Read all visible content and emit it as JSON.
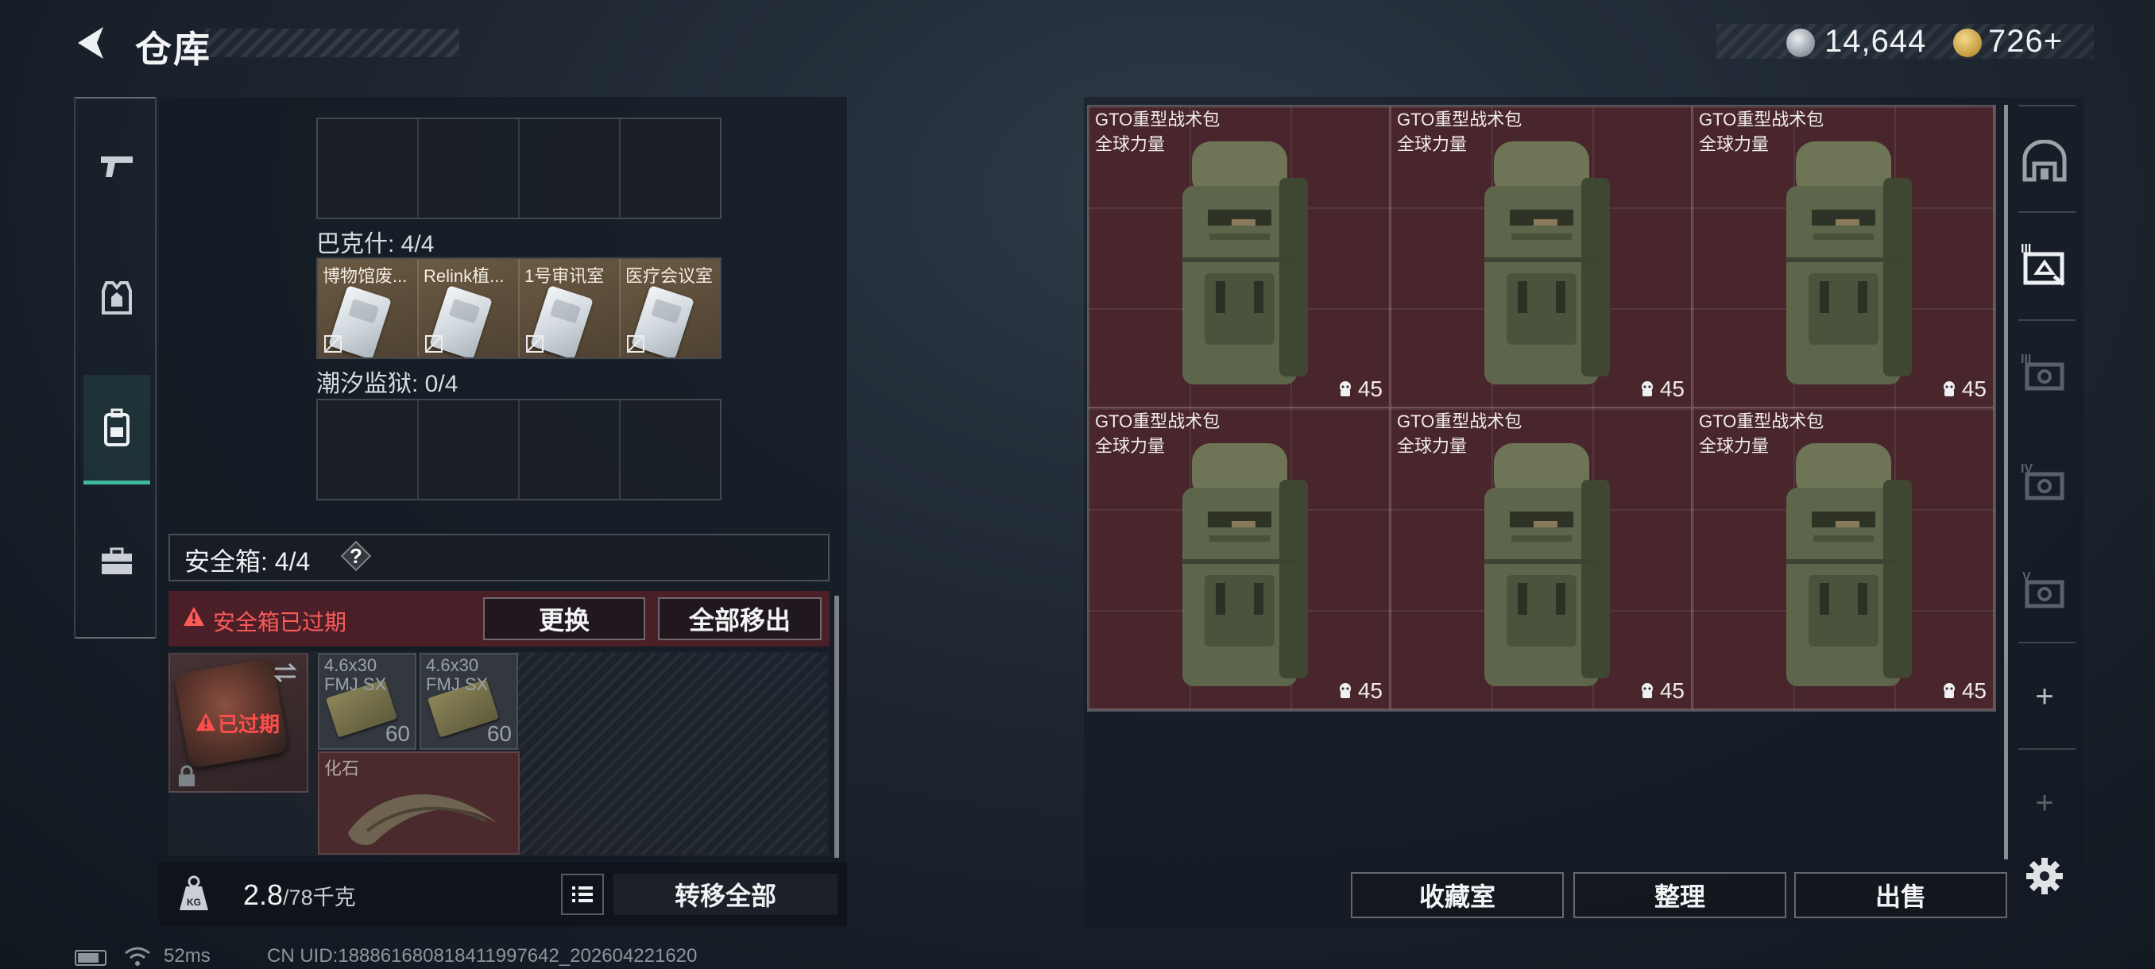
{
  "header": {
    "title": "仓库"
  },
  "currency": {
    "silver": "14,644",
    "gold": "726+"
  },
  "left_nav": [
    "gun-icon",
    "armor-icon",
    "backpack-icon",
    "briefcase-icon"
  ],
  "keys": {
    "top_label": "",
    "bakesh_label": "巴克什: 4/4",
    "bakesh_items": [
      "博物馆废...",
      "Relink植...",
      "1号审讯室",
      "医疗会议室"
    ],
    "tide_label": "潮汐监狱: 0/4"
  },
  "safebox": {
    "title": "安全箱: 4/4",
    "help": "?",
    "warning": "安全箱已过期",
    "replace_button": "更换",
    "move_all_button": "全部移出",
    "expired_badge": "已过期",
    "items": [
      {
        "name": "4.6x30 FMJ SX",
        "count": "60"
      },
      {
        "name": "4.6x30 FMJ SX",
        "count": "60"
      }
    ],
    "fossil_name": "化石"
  },
  "weight": {
    "current": "2.8",
    "max": "/78千克"
  },
  "transfer_all_button": "转移全部",
  "storage": {
    "items": [
      {
        "name": "GTO重型战术包",
        "brand": "全球力量",
        "durability": "45"
      },
      {
        "name": "GTO重型战术包",
        "brand": "全球力量",
        "durability": "45"
      },
      {
        "name": "GTO重型战术包",
        "brand": "全球力量",
        "durability": "45"
      },
      {
        "name": "GTO重型战术包",
        "brand": "全球力量",
        "durability": "45"
      },
      {
        "name": "GTO重型战术包",
        "brand": "全球力量",
        "durability": "45"
      },
      {
        "name": "GTO重型战术包",
        "brand": "全球力量",
        "durability": "45"
      }
    ],
    "buttons": {
      "collection": "收藏室",
      "organize": "整理",
      "sell": "出售"
    }
  },
  "right_nav": {
    "tier3": "III",
    "tier4": "IV",
    "tier5": "V",
    "plus": "+"
  },
  "status": {
    "ping": "52ms",
    "uid": "CN UID:188861680818411997642_202604221620"
  },
  "colors": {
    "accent": "#3fb8a0",
    "warning": "#ff5a5a",
    "cell_red": "#48262c"
  }
}
